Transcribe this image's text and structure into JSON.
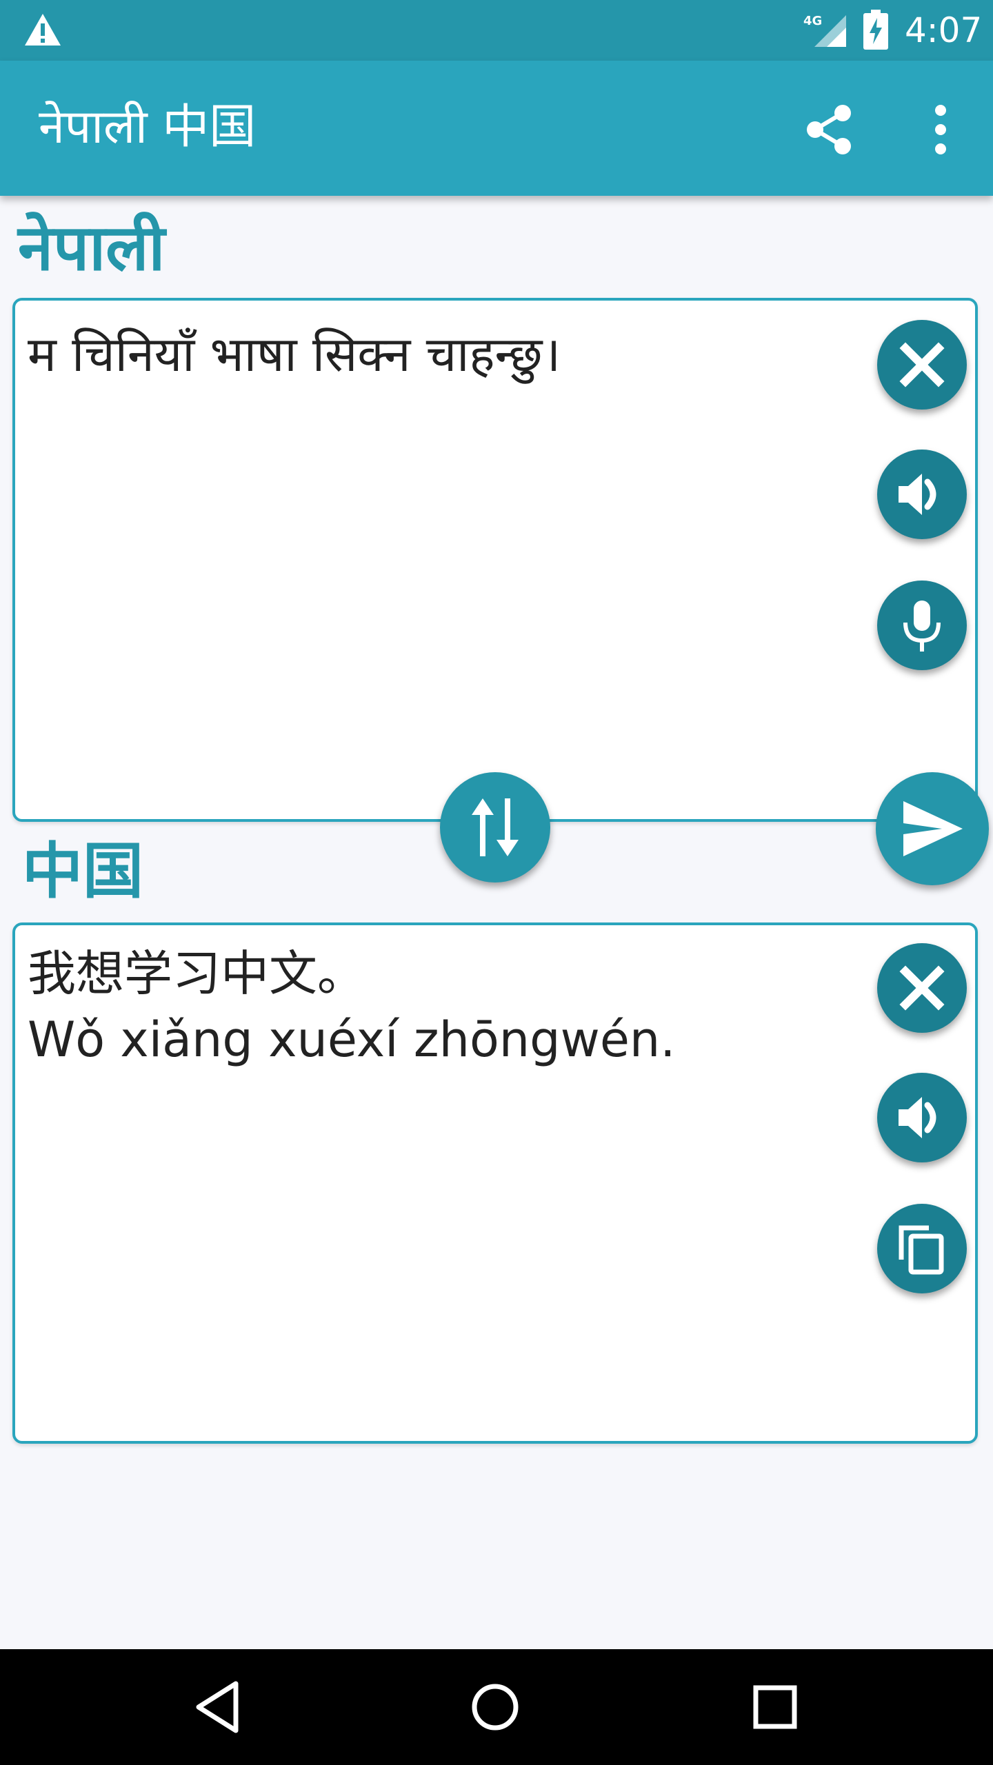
{
  "status_bar": {
    "time": "4:07",
    "network": "4G",
    "icons": [
      "warning-icon",
      "signal-icon",
      "battery-charging-icon"
    ]
  },
  "app_bar": {
    "title": "नेपाली 中国",
    "actions": [
      "share-icon",
      "more-vert-icon"
    ]
  },
  "source": {
    "language": "नेपाली",
    "text": "म चिनियाँ भाषा सिक्न चाहन्छु।",
    "buttons": [
      "clear-icon",
      "speaker-icon",
      "microphone-icon"
    ]
  },
  "target": {
    "language": "中国",
    "text": "我想学习中文。",
    "pinyin": "Wǒ xiǎng xuéxí zhōngwén.",
    "buttons": [
      "clear-icon",
      "speaker-icon",
      "copy-icon"
    ]
  },
  "center_buttons": [
    "swap-icon",
    "send-icon"
  ],
  "nav_bar": [
    "back-icon",
    "home-icon",
    "recents-icon"
  ],
  "colors": {
    "status_bar": "#2596aa",
    "app_bar": "#2aa5bd",
    "accent": "#2596aa",
    "button": "#1b7f91",
    "background": "#f6f7fb",
    "nav_bar": "#000000"
  }
}
